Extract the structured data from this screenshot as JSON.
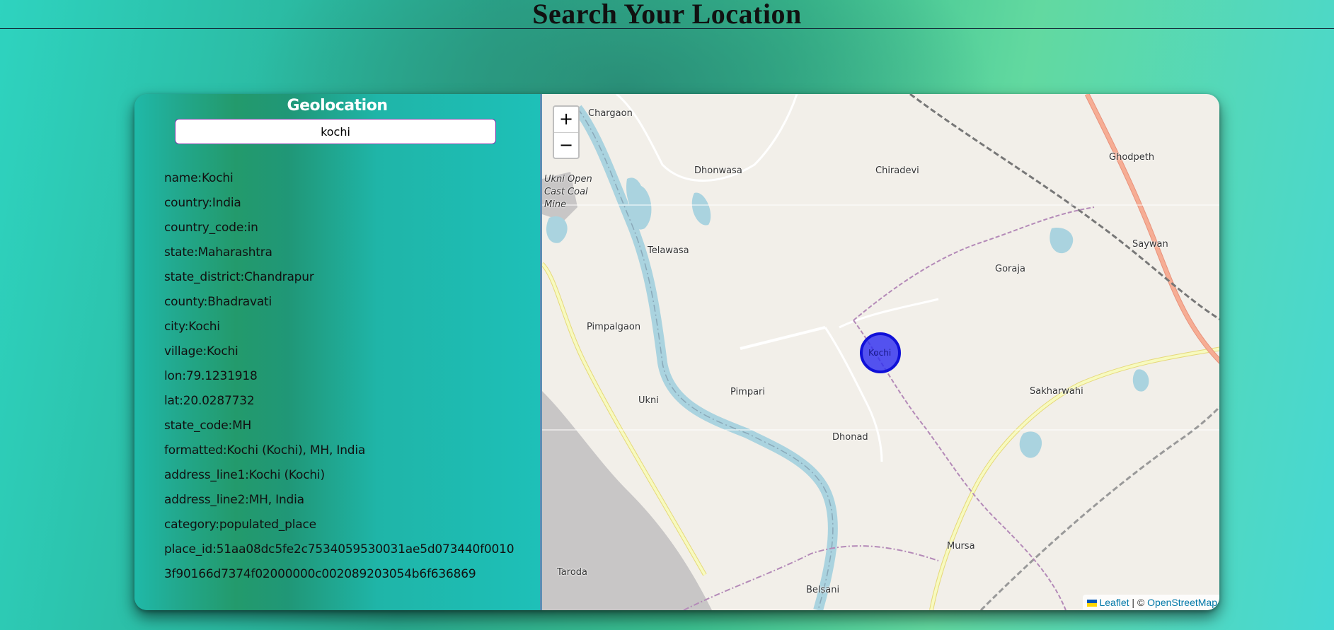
{
  "page": {
    "title": "Search Your Location"
  },
  "panel": {
    "title": "Geolocation",
    "search_value": "kochi"
  },
  "results": [
    "name:Kochi",
    "country:India",
    "country_code:in",
    "state:Maharashtra",
    "state_district:Chandrapur",
    "county:Bhadravati",
    "city:Kochi",
    "village:Kochi",
    "lon:79.1231918",
    "lat:20.0287732",
    "state_code:MH",
    "formatted:Kochi (Kochi), MH, India",
    "address_line1:Kochi (Kochi)",
    "address_line2:MH, India",
    "category:populated_place",
    "place_id:51aa08dc5fe2c7534059530031ae5d073440f0010",
    "3f90166d7374f02000000c002089203054b6f636869"
  ],
  "map": {
    "zoom_in": "+",
    "zoom_out": "−",
    "marker_label": "Kochi",
    "marker_color": "#2a2af0",
    "attribution": {
      "leaflet": "Leaflet",
      "sep": " | © ",
      "osm": "OpenStreetMap"
    },
    "places": {
      "chargaon": "Chargaon",
      "dhonwasa": "Dhonwasa",
      "chiradevi": "Chiradevi",
      "ghodpeth": "Ghodpeth",
      "ukni_mine": "Ukni Open\nCast Coal\nMine",
      "telawasa": "Telawasa",
      "goraja": "Goraja",
      "saywan": "Saywan",
      "pimpalgaon": "Pimpalgaon",
      "ukni": "Ukni",
      "pimpari": "Pimpari",
      "sakharwahi": "Sakharwahi",
      "dhonad": "Dhonad",
      "mursa": "Mursa",
      "taroda": "Taroda",
      "belsani": "Belsani"
    }
  }
}
